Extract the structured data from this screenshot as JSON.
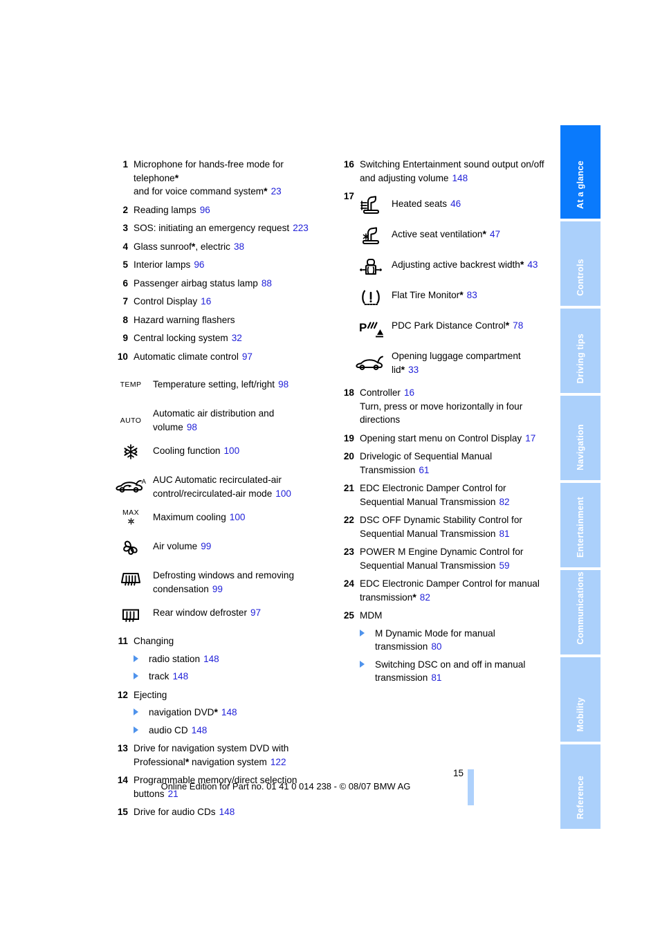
{
  "document": {
    "page_number": "15",
    "footer_text": "Online Edition for Part no. 01 41 0 014 238 - © 08/07 BMW AG"
  },
  "colors": {
    "link_blue": "#1f1fd8",
    "tab_active": "#0a7afc",
    "tab_inactive": "#abd0fb",
    "bullet_blue": "#4f93ec",
    "footer_bar": "#aed1fc"
  },
  "left_column": {
    "entries": [
      {
        "num": "1",
        "text": "Microphone for hands-free mode for telephone*",
        "text2": "and for voice command system*",
        "page": "23"
      },
      {
        "num": "2",
        "text": "Reading lamps",
        "page": "96"
      },
      {
        "num": "3",
        "text": "SOS: initiating an emergency request",
        "page": "223"
      },
      {
        "num": "4",
        "text": "Glass sunroof*, electric",
        "page": "38"
      },
      {
        "num": "5",
        "text": "Interior lamps",
        "page": "96"
      },
      {
        "num": "6",
        "text": "Passenger airbag status lamp",
        "page": "88"
      },
      {
        "num": "7",
        "text": "Control Display",
        "page": "16"
      },
      {
        "num": "8",
        "text": "Hazard warning flashers",
        "page": ""
      },
      {
        "num": "9",
        "text": "Central locking system",
        "page": "32"
      },
      {
        "num": "10",
        "text": "Automatic climate control",
        "page": "97"
      }
    ],
    "climate_icons": [
      {
        "icon": "temp-label-icon",
        "label": "TEMP",
        "text": "Temperature setting, left/right",
        "page": "98"
      },
      {
        "icon": "auto-label-icon",
        "label": "AUTO",
        "text": "Automatic air distribution and volume",
        "page": "98"
      },
      {
        "icon": "snowflake-icon",
        "label": "",
        "text": "Cooling function",
        "page": "100"
      },
      {
        "icon": "auc-recirculated-air-icon",
        "label": "A",
        "text": "AUC Automatic recirculated-air control/recirculated-air mode",
        "page": "100"
      },
      {
        "icon": "max-cooling-icon",
        "label": "MAX",
        "text": "Maximum cooling",
        "page": "100"
      },
      {
        "icon": "fan-icon",
        "label": "",
        "text": "Air volume",
        "page": "99"
      },
      {
        "icon": "windshield-defrost-icon",
        "label": "",
        "text": "Defrosting windows and removing condensation",
        "page": "99"
      },
      {
        "icon": "rear-window-defroster-icon",
        "label": "",
        "text": "Rear window defroster",
        "page": "97"
      }
    ],
    "entries_bottom": [
      {
        "num": "11",
        "text": "Changing",
        "page": "",
        "subitems": [
          {
            "text": "radio station",
            "page": "148"
          },
          {
            "text": "track",
            "page": "148"
          }
        ]
      },
      {
        "num": "12",
        "text": "Ejecting",
        "page": "",
        "subitems": [
          {
            "text": "navigation DVD*",
            "page": "148"
          },
          {
            "text": "audio CD",
            "page": "148"
          }
        ]
      },
      {
        "num": "13",
        "text": "Drive for navigation system DVD with Professional* navigation system",
        "page": "122"
      },
      {
        "num": "14",
        "text": "Programmable memory/direct selection buttons",
        "page": "21"
      },
      {
        "num": "15",
        "text": "Drive for audio CDs",
        "page": "148"
      }
    ]
  },
  "right_column": {
    "entry_16": {
      "num": "16",
      "text": "Switching Entertainment sound output on/off and adjusting volume",
      "page": "148"
    },
    "entry_17_num": "17",
    "seat_icons": [
      {
        "icon": "heated-seat-icon",
        "text": "Heated seats",
        "page": "46"
      },
      {
        "icon": "active-seat-ventilation-icon",
        "text": "Active seat ventilation*",
        "page": "47"
      },
      {
        "icon": "active-backrest-width-icon",
        "text": "Adjusting active backrest width*",
        "page": "43"
      },
      {
        "icon": "flat-tire-monitor-icon",
        "text": "Flat Tire Monitor*",
        "page": "83"
      },
      {
        "icon": "pdc-park-distance-control-icon",
        "text": "PDC Park Distance Control*",
        "page": "78"
      },
      {
        "icon": "luggage-compartment-lid-icon",
        "text": "Opening luggage compartment lid*",
        "page": "33"
      }
    ],
    "entries": [
      {
        "num": "18",
        "text": "Controller",
        "page": "16",
        "text2": "Turn, press or move horizontally in four directions"
      },
      {
        "num": "19",
        "text": "Opening start menu on Control Display",
        "page": "17"
      },
      {
        "num": "20",
        "text": "Drivelogic of Sequential Manual Transmission",
        "page": "61"
      },
      {
        "num": "21",
        "text": "EDC Electronic Damper Control for Sequential Manual Transmission",
        "page": "82"
      },
      {
        "num": "22",
        "text": "DSC OFF Dynamic Stability Control for Sequential Manual Transmission",
        "page": "81"
      },
      {
        "num": "23",
        "text": "POWER M Engine Dynamic Control for Sequential Manual Transmission",
        "page": "59"
      },
      {
        "num": "24",
        "text": "EDC Electronic Damper Control for manual transmission*",
        "page": "82"
      },
      {
        "num": "25",
        "text": "MDM",
        "page": "",
        "subitems": [
          {
            "text": "M Dynamic Mode for manual transmission",
            "page": "80"
          },
          {
            "text": "Switching DSC on and off in manual transmission",
            "page": "81"
          }
        ]
      }
    ]
  },
  "sidebar": {
    "tabs": [
      {
        "label": "At a glance",
        "active": true
      },
      {
        "label": "Controls",
        "active": false
      },
      {
        "label": "Driving tips",
        "active": false
      },
      {
        "label": "Navigation",
        "active": false
      },
      {
        "label": "Entertainment",
        "active": false
      },
      {
        "label": "Communications",
        "active": false
      },
      {
        "label": "Mobility",
        "active": false
      },
      {
        "label": "Reference",
        "active": false
      }
    ]
  }
}
